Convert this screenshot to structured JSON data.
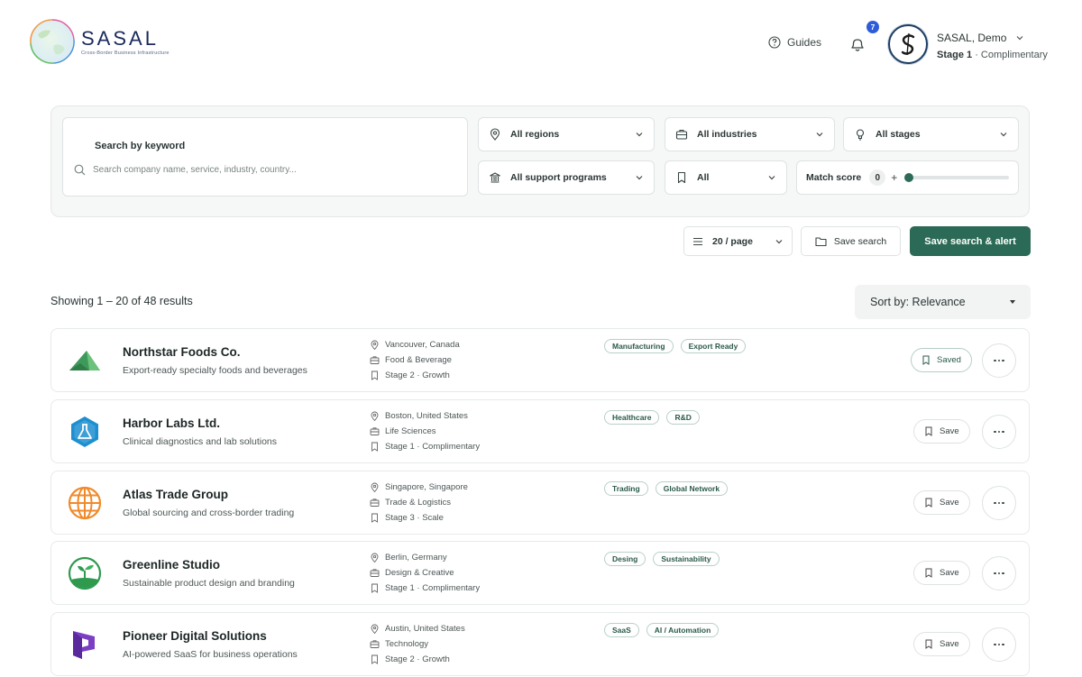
{
  "brand": {
    "name": "SASAL",
    "tagline": "Cross-Border Business Infrastructure"
  },
  "header": {
    "guides_label": "Guides",
    "notification_count": "7",
    "user_name": "SASAL, Demo",
    "user_stage": "Stage 1",
    "user_plan": "Complimentary"
  },
  "filters": {
    "search_label": "Search by keyword",
    "search_placeholder": "Search company name, service, industry, country...",
    "regions": "All regions",
    "industries": "All industries",
    "stages": "All stages",
    "support_programs": "All support programs",
    "bookmark_filter": "All",
    "match_score_label": "Match score",
    "match_score_value": "0",
    "match_score_plus": "+",
    "match_score_fraction": 0
  },
  "actions": {
    "per_page": "20 / page",
    "save_search": "Save search",
    "save_search_alert": "Save search & alert"
  },
  "results": {
    "showing": "Showing 1 – 20 of 48 results",
    "sort_label": "Sort by: Relevance",
    "items": [
      {
        "name": "Northstar Foods Co.",
        "description": "Export-ready specialty foods and beverages",
        "location": "Vancouver, Canada",
        "industry": "Food & Beverage",
        "stage": "Stage 2 · Growth",
        "tags": [
          "Manufacturing",
          "Export Ready"
        ],
        "save_label": "Saved",
        "saved": true,
        "logo_icon": "mountain-logo-icon"
      },
      {
        "name": "Harbor Labs Ltd.",
        "description": "Clinical diagnostics and lab solutions",
        "location": "Boston, United States",
        "industry": "Life Sciences",
        "stage": "Stage 1 · Complimentary",
        "tags": [
          "Healthcare",
          "R&D"
        ],
        "save_label": "Save",
        "saved": false,
        "logo_icon": "flask-logo-icon"
      },
      {
        "name": "Atlas Trade Group",
        "description": "Global sourcing and cross-border trading",
        "location": "Singapore, Singapore",
        "industry": "Trade & Logistics",
        "stage": "Stage 3 · Scale",
        "tags": [
          "Trading",
          "Global Network"
        ],
        "save_label": "Save",
        "saved": false,
        "logo_icon": "globe-logo-icon"
      },
      {
        "name": "Greenline Studio",
        "description": "Sustainable product design and branding",
        "location": "Berlin, Germany",
        "industry": "Design & Creative",
        "stage": "Stage 1 · Complimentary",
        "tags": [
          "Desing",
          "Sustainability"
        ],
        "save_label": "Save",
        "saved": false,
        "logo_icon": "sprout-logo-icon"
      },
      {
        "name": "Pioneer Digital Solutions",
        "description": "AI-powered SaaS for business operations",
        "location": "Austin, United States",
        "industry": "Technology",
        "stage": "Stage 2 · Growth",
        "tags": [
          "SaaS",
          "AI / Automation"
        ],
        "save_label": "Save",
        "saved": false,
        "logo_icon": "p-letter-logo-icon"
      }
    ]
  },
  "colors": {
    "primary": "#2b6a56",
    "badge": "#2e5bd8",
    "tag_border": "#b9d0c7"
  }
}
